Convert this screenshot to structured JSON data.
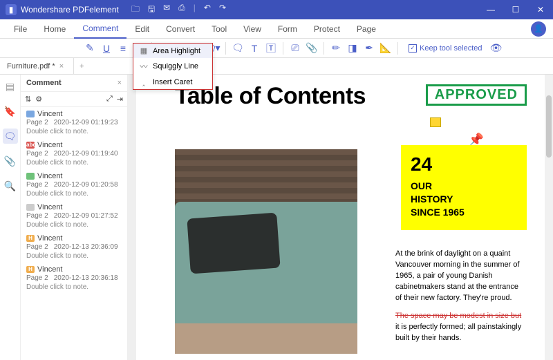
{
  "titlebar": {
    "app": "Wondershare PDFelement"
  },
  "menubar": {
    "items": [
      "File",
      "Home",
      "Comment",
      "Edit",
      "Convert",
      "Tool",
      "View",
      "Form",
      "Protect",
      "Page"
    ],
    "activeIndex": 2
  },
  "toolbar": {
    "keep_label": "Keep tool selected"
  },
  "tabs": {
    "items": [
      {
        "label": "Furniture.pdf *"
      }
    ]
  },
  "panel": {
    "title": "Comment",
    "entries": [
      {
        "badge": "#7aa7e0",
        "badgeText": "",
        "author": "Vincent",
        "page": "Page 2",
        "ts": "2020-12-09 01:19:23",
        "note": "Double click to note."
      },
      {
        "badge": "#d9534f",
        "badgeText": "abc",
        "author": "Vincent",
        "page": "Page 2",
        "ts": "2020-12-09 01:19:40",
        "note": "Double click to note."
      },
      {
        "badge": "#6fc27a",
        "badgeText": "",
        "author": "Vincent",
        "page": "Page 2",
        "ts": "2020-12-09 01:20:58",
        "note": "Double click to note."
      },
      {
        "badge": "#cccccc",
        "badgeText": "",
        "author": "Vincent",
        "page": "Page 2",
        "ts": "2020-12-09 01:27:52",
        "note": "Double click to note."
      },
      {
        "badge": "#f0ad4e",
        "badgeText": "H",
        "author": "Vincent",
        "page": "Page 2",
        "ts": "2020-12-13 20:36:09",
        "note": "Double click to note."
      },
      {
        "badge": "#f0ad4e",
        "badgeText": "H",
        "author": "Vincent",
        "page": "Page 2",
        "ts": "2020-12-13 20:36:18",
        "note": "Double click to note."
      }
    ]
  },
  "dropdown": {
    "items": [
      "Area Highlight",
      "Squiggly Line",
      "Insert Caret"
    ],
    "selectedIndex": 0
  },
  "doc": {
    "title": "Table of Contents",
    "stamp": "APPROVED",
    "feature": {
      "num": "24",
      "line1": "OUR",
      "line2": "HISTORY",
      "line3": "SINCE 1965"
    },
    "para1": "At the brink of daylight on a quaint Vancouver morning in the summer of 1965, a pair of young Danish cabinetmakers stand at the entrance of their new factory. They're proud.",
    "para2_strike": "The space may be modest in size but",
    "para2_rest": " it is perfectly formed; all painstakingly built by their hands."
  }
}
